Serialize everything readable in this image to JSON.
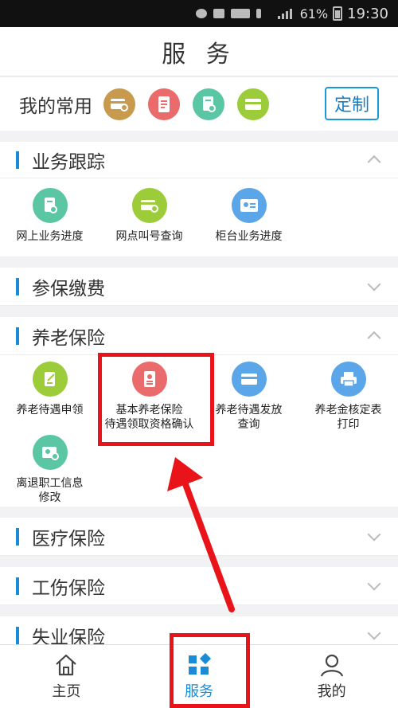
{
  "statusbar": {
    "battery": "61%",
    "time": "19:30"
  },
  "title": "服 务",
  "favorites": {
    "label": "我的常用",
    "icons": [
      {
        "name": "card-search-icon",
        "color": "#c79a4e"
      },
      {
        "name": "document-icon",
        "color": "#ea6b6b"
      },
      {
        "name": "doc-check-icon",
        "color": "#5bc6a4"
      },
      {
        "name": "card-icon",
        "color": "#9ccc3a"
      }
    ],
    "custom_label": "定制"
  },
  "sections": {
    "business": {
      "title": "业务跟踪",
      "items": [
        {
          "label": "网上业务进度",
          "icon": "doc-check-icon",
          "color": "#5bc6a4"
        },
        {
          "label": "网点叫号查询",
          "icon": "card-search-icon",
          "color": "#9ccc3a"
        },
        {
          "label": "柜台业务进度",
          "icon": "id-card-icon",
          "color": "#5aa6e8"
        }
      ]
    },
    "insurance_payment": {
      "title": "参保缴费"
    },
    "pension": {
      "title": "养老保险",
      "items": [
        {
          "label": "养老待遇申领",
          "icon": "edit-doc-icon",
          "color": "#9ccc3a"
        },
        {
          "label_line1": "基本养老保险",
          "label_line2": "待遇领取资格确认",
          "icon": "id-badge-icon",
          "color": "#ea6b6b"
        },
        {
          "label_line1": "养老待遇发放",
          "label_line2": "查询",
          "icon": "card-icon",
          "color": "#5aa6e8"
        },
        {
          "label_line1": "养老金核定表",
          "label_line2": "打印",
          "icon": "printer-icon",
          "color": "#5aa6e8"
        },
        {
          "label_line1": "离退职工信息",
          "label_line2": "修改",
          "icon": "id-search-icon",
          "color": "#5bc6a4"
        }
      ]
    },
    "medical": {
      "title": "医疗保险"
    },
    "injury": {
      "title": "工伤保险"
    },
    "unemployment": {
      "title": "失业保险"
    }
  },
  "tabs": [
    {
      "label": "主页",
      "icon": "home-icon"
    },
    {
      "label": "服务",
      "icon": "services-icon",
      "active_color": "#1a8bd6"
    },
    {
      "label": "我的",
      "icon": "user-icon"
    }
  ],
  "colors": {
    "accent": "#1a8bd6",
    "highlight": "#e8141a"
  }
}
